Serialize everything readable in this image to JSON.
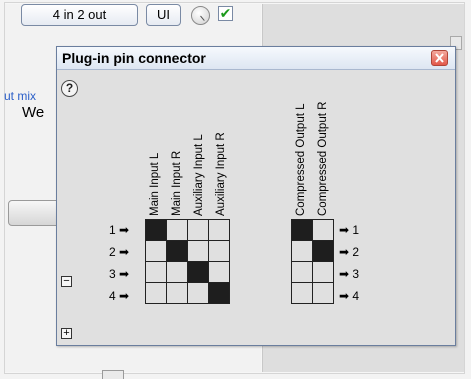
{
  "host": {
    "routing_button_label": "4 in 2 out",
    "ui_button_label": "UI",
    "checkbox_mark": "✔",
    "wet_label": "ut mix",
    "wet_sub_label": "We"
  },
  "dialog": {
    "title": "Plug-in pin connector",
    "help_label": "?",
    "close_icon": "close-icon",
    "inputs": {
      "columns": [
        "Main Input L",
        "Main Input R",
        "Auxiliary Input L",
        "Auxiliary Input R"
      ],
      "rows": [
        "1 ➡",
        "2 ➡",
        "3 ➡",
        "4 ➡"
      ],
      "matrix": [
        [
          1,
          0,
          0,
          0
        ],
        [
          0,
          1,
          0,
          0
        ],
        [
          0,
          0,
          1,
          0
        ],
        [
          0,
          0,
          0,
          1
        ]
      ]
    },
    "outputs": {
      "columns": [
        "Compressed Output L",
        "Compressed Output R"
      ],
      "rows": [
        "➡ 1",
        "➡ 2",
        "➡ 3",
        "➡ 4"
      ],
      "matrix": [
        [
          1,
          0
        ],
        [
          0,
          1
        ],
        [
          0,
          0
        ],
        [
          0,
          0
        ]
      ]
    },
    "collapse_label": "−",
    "expand_label": "+"
  },
  "colors": {
    "pin_on": "#1e1e1e",
    "pin_off": "#e0e0e0",
    "dialog_bg": "#e0e0e0",
    "close_red": "#e2584a"
  }
}
